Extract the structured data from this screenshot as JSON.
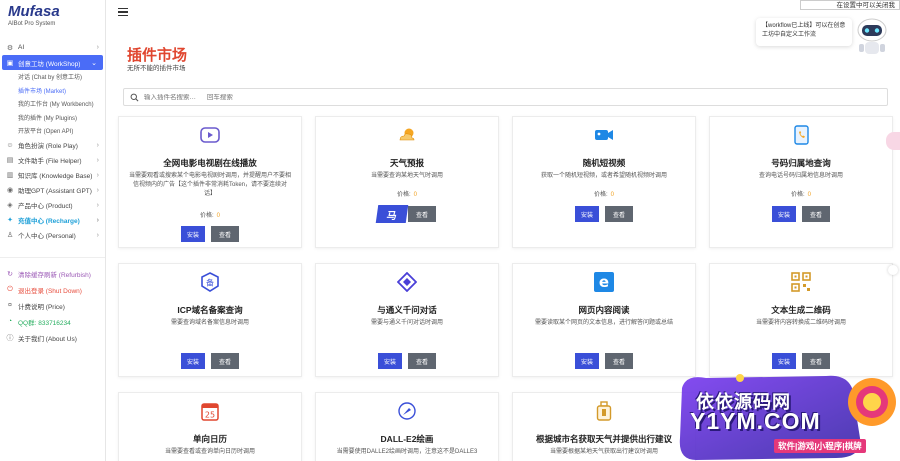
{
  "app": {
    "logo_title": "Mufasa",
    "logo_sub": "AIBot Pro System"
  },
  "sidebar": {
    "items": [
      {
        "label": "AI",
        "icon": "gear-icon"
      },
      {
        "label": "创意工坊 (WorkShop)",
        "icon": "workshop-icon"
      },
      {
        "label": "角色扮演 (Role Play)",
        "icon": "role-icon"
      },
      {
        "label": "文件助手 (File Helper)",
        "icon": "file-icon"
      },
      {
        "label": "知识库 (Knowledge Base)",
        "icon": "book-icon"
      },
      {
        "label": "助理GPT (Assistant GPT)",
        "icon": "assistant-icon"
      },
      {
        "label": "产品中心 (Product)",
        "icon": "product-icon"
      },
      {
        "label": "充值中心 (Recharge)",
        "icon": "recharge-icon"
      },
      {
        "label": "个人中心 (Personal)",
        "icon": "user-icon"
      }
    ],
    "sub_items": [
      {
        "label": "对话 (Chat by 创意工坊)"
      },
      {
        "label": "插件市场 (Market)"
      },
      {
        "label": "我的工作台 (My Workbench)"
      },
      {
        "label": "我的插件 (My Plugins)"
      },
      {
        "label": "开放平台 (Open API)"
      }
    ],
    "bottom_items": [
      {
        "label": "清除缓存刷新 (Refurbish)",
        "icon": "refresh-icon"
      },
      {
        "label": "退出登录 (Shut Down)",
        "icon": "power-icon"
      },
      {
        "label": "计费说明 (Price)",
        "icon": "price-icon"
      },
      {
        "label": "QQ群: 833716234",
        "icon": "qq-icon"
      },
      {
        "label": "关于我们 (About Us)",
        "icon": "info-icon"
      }
    ]
  },
  "main": {
    "title": "插件市场",
    "subtitle": "无所不能的插件市场",
    "search_placeholder": "输入插件名搜索…      回车搜索"
  },
  "price_label": "价格:",
  "price_value": "0",
  "install_label": "安装",
  "view_label": "查看",
  "cards": [
    {
      "name": "全网电影电视剧在线播放",
      "desc": "当需要观看或搜索某个电影电视剧时调用，并提醒用户不要相信视频内的广告【这个插件非常消耗Token，请不要连续对话】",
      "icon": "video-icon",
      "color": "#6a5acd"
    },
    {
      "name": "天气预报",
      "desc": "当需要查询某地天气时调用",
      "icon": "weather-icon",
      "color": "#f5a623"
    },
    {
      "name": "随机短视频",
      "desc": "获取一个随机短视频，或者希望随机视频时调用",
      "icon": "camera-icon",
      "color": "#1e88e5"
    },
    {
      "name": "号码归属地查询",
      "desc": "查询电话号码归属地信息时调用",
      "icon": "phonebook-icon",
      "color": "#1e88e5"
    },
    {
      "name": "ICP域名备案查询",
      "desc": "需要查询域名备案信息时调用",
      "icon": "icp-icon",
      "color": "#3a4fd8"
    },
    {
      "name": "与通义千问对话",
      "desc": "需要与通义千问对话时调用",
      "icon": "tongyi-icon",
      "color": "#4a3fd8"
    },
    {
      "name": "网页内容阅读",
      "desc": "需要读取某个网页的文本信息，进行解答问题或总结",
      "icon": "ie-icon",
      "color": "#1e88e5"
    },
    {
      "name": "文本生成二维码",
      "desc": "当需要将内容转换成二维码时调用",
      "icon": "qrcode-icon",
      "color": "#d39a2a"
    },
    {
      "name": "单向日历",
      "desc": "当需要查看或查询单向日历时调用",
      "icon": "calendar-icon",
      "color": "#e0462f"
    },
    {
      "name": "DALL-E2绘画",
      "desc": "当需要使用DALLE2绘画时调用，注意这不是DALLE3",
      "icon": "dalle-icon",
      "color": "#3a4fd8"
    },
    {
      "name": "根据城市名获取天气并提供出行建议",
      "desc": "当需要根据某地天气获取出行建议时调用",
      "icon": "luggage-icon",
      "color": "#d39a2a"
    }
  ],
  "notice": {
    "top": "在设置中可以关闭我",
    "bubble": "【workflow已上线】可以在创意工坊中自定义工作流"
  },
  "watermark": {
    "title": "依依源码网",
    "url": "Y1YM.COM",
    "tag": "软件|游戏|小程序|棋牌"
  },
  "sticker_text": "马"
}
